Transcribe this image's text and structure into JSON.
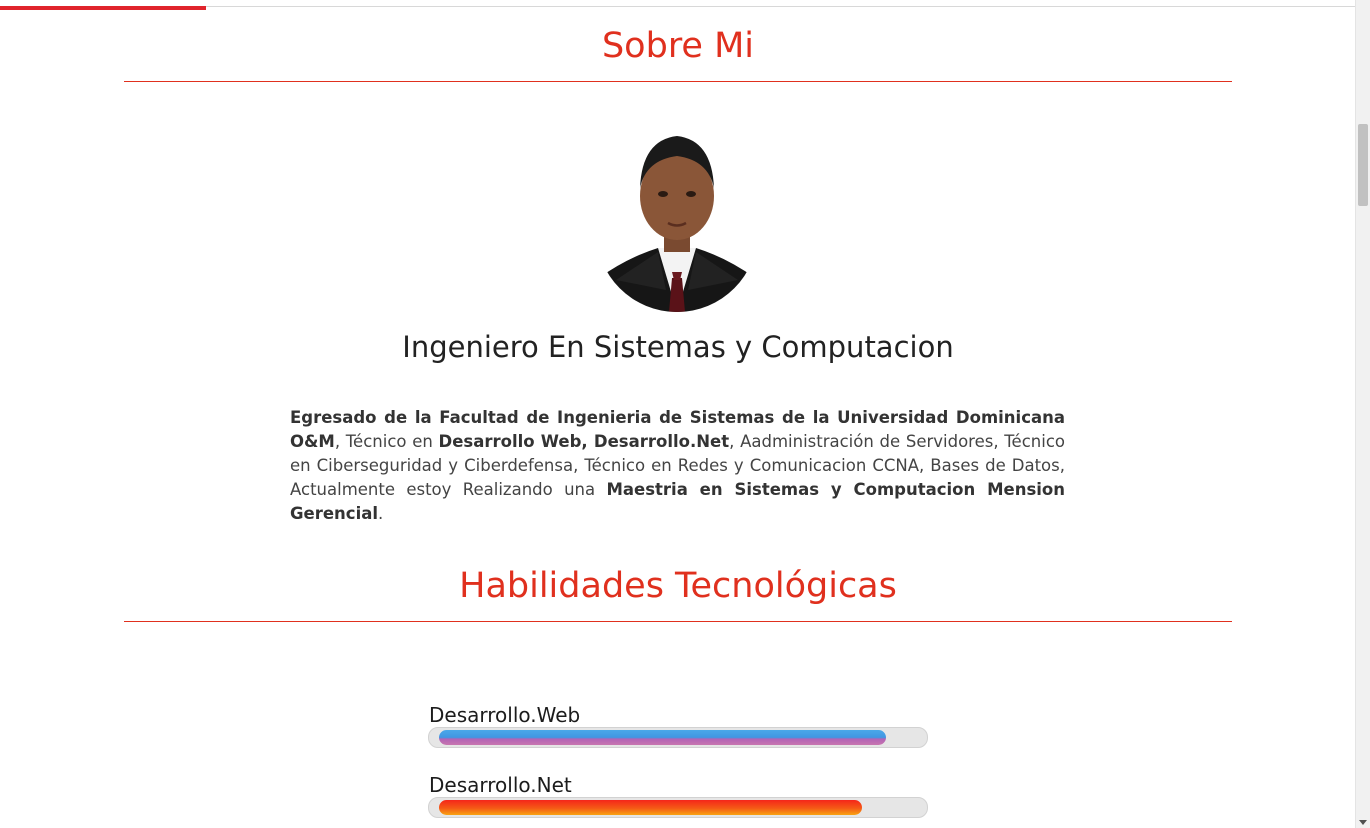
{
  "about": {
    "title": "Sobre Mi",
    "profession": "Ingeniero En Sistemas y Computacion",
    "bio": {
      "p1_bold": "Egresado de la Facultad de Ingenieria de Sistemas de la Universidad Dominicana O&M",
      "p2": ", Técnico en ",
      "p3_bold": "Desarrollo Web, Desarrollo.Net",
      "p4": ", Aadministración de Servidores, Técnico en Ciberseguridad y Ciberdefensa, Técnico en Redes y Comunicacion CCNA, Bases de Datos, Actualmente estoy Realizando una ",
      "p5_bold": "Maestria en Sistemas y Computacion Mension Gerencial",
      "p6": "."
    }
  },
  "skills": {
    "title": "Habilidades Tecnológicas",
    "items": [
      {
        "label": "Desarrollo.Web",
        "level": 0.92
      },
      {
        "label": "Desarrollo.Net",
        "level": 0.87
      }
    ]
  },
  "colors": {
    "accent": "#e0301e",
    "topbar_accent": "#e0242c"
  }
}
